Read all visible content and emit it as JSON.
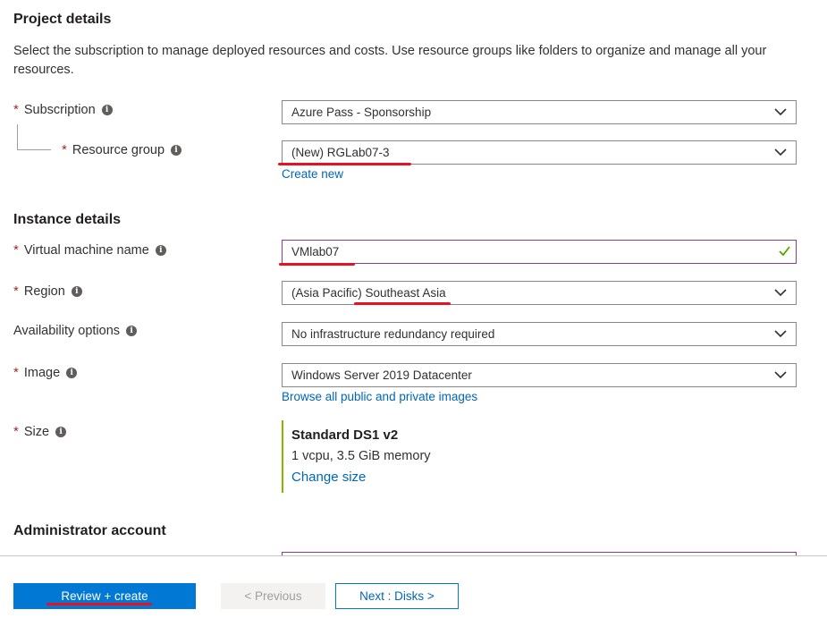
{
  "project": {
    "heading": "Project details",
    "description": "Select the subscription to manage deployed resources and costs. Use resource groups like folders to organize and manage all your resources."
  },
  "subscription": {
    "label": "Subscription",
    "value": "Azure Pass - Sponsorship"
  },
  "resource_group": {
    "label": "Resource group",
    "value": "(New) RGLab07-3",
    "create_link": "Create new"
  },
  "instance": {
    "heading": "Instance details"
  },
  "vm_name": {
    "label": "Virtual machine name",
    "value": "VMlab07"
  },
  "region": {
    "label": "Region",
    "value": "(Asia Pacific) Southeast Asia"
  },
  "availability": {
    "label": "Availability options",
    "value": "No infrastructure redundancy required"
  },
  "image": {
    "label": "Image",
    "value": "Windows Server 2019 Datacenter",
    "browse_link": "Browse all public and private images"
  },
  "size": {
    "label": "Size",
    "name": "Standard DS1 v2",
    "spec": "1 vcpu, 3.5 GiB memory",
    "change_link": "Change size"
  },
  "admin": {
    "heading": "Administrator account"
  },
  "common": {
    "required_mark": "*",
    "info_glyph": "i"
  },
  "footer": {
    "review_create": "Review + create",
    "previous": "< Previous",
    "next": "Next : Disks >"
  },
  "colors": {
    "accent": "#0078d4",
    "annotation": "#e81123",
    "valid": "#57a300",
    "size_border": "#7fba00",
    "required": "#a4262c"
  },
  "icons": {
    "dropdown": "chevron-down-icon",
    "valid": "checkmark-icon",
    "info": "info-icon"
  }
}
